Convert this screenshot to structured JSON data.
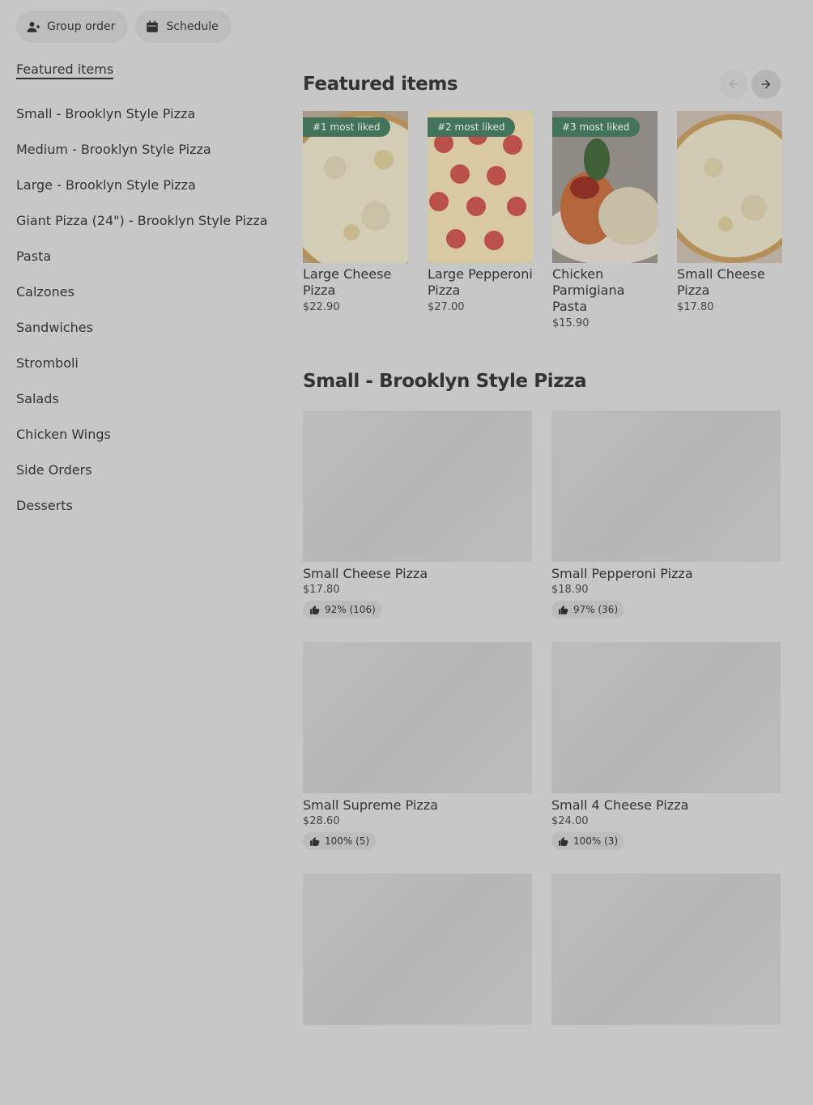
{
  "topbar": {
    "group_order": {
      "label": "Group order",
      "icon": "person-add-icon"
    },
    "schedule": {
      "label": "Schedule",
      "icon": "calendar-icon"
    }
  },
  "sidebar": {
    "items": [
      {
        "label": "Featured items",
        "active": true
      },
      {
        "label": "Small - Brooklyn Style Pizza"
      },
      {
        "label": "Medium - Brooklyn Style Pizza"
      },
      {
        "label": "Large - Brooklyn Style Pizza"
      },
      {
        "label": "Giant Pizza (24\") - Brooklyn Style Pizza"
      },
      {
        "label": "Pasta"
      },
      {
        "label": "Calzones"
      },
      {
        "label": "Sandwiches"
      },
      {
        "label": "Stromboli"
      },
      {
        "label": "Salads"
      },
      {
        "label": "Chicken Wings"
      },
      {
        "label": "Side Orders"
      },
      {
        "label": "Desserts"
      }
    ]
  },
  "featured": {
    "title": "Featured items",
    "items": [
      {
        "badge": "#1 most liked",
        "name": "Large Cheese Pizza",
        "price": "$22.90",
        "image": "cheese-pizza"
      },
      {
        "badge": "#2 most liked",
        "name": "Large Pepperoni Pizza",
        "price": "$27.00",
        "image": "pepperoni-pizza"
      },
      {
        "badge": "#3 most liked",
        "name": "Chicken Parmigiana Pasta",
        "price": "$15.90",
        "image": "chicken-parmigiana"
      },
      {
        "badge": "",
        "name": "Small Cheese Pizza",
        "price": "$17.80",
        "image": "cheese-pizza"
      }
    ]
  },
  "section": {
    "title": "Small - Brooklyn Style Pizza",
    "items": [
      {
        "name": "Small Cheese Pizza",
        "price": "$17.80",
        "rating": "92% (106)"
      },
      {
        "name": "Small Pepperoni Pizza",
        "price": "$18.90",
        "rating": "97% (36)"
      },
      {
        "name": "Small Supreme Pizza",
        "price": "$28.60",
        "rating": "100% (5)"
      },
      {
        "name": "Small 4 Cheese Pizza",
        "price": "$24.00",
        "rating": "100% (3)"
      }
    ]
  },
  "colors": {
    "background": "#c7c7c7",
    "badge": "#43735a"
  }
}
